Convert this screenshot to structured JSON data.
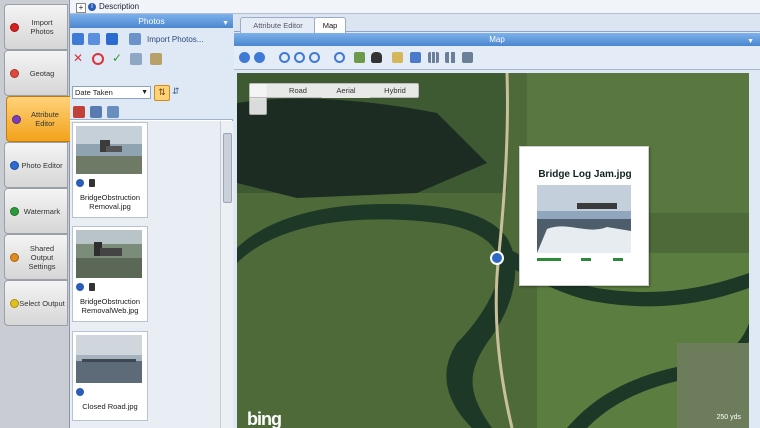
{
  "top_strip": {
    "description_label": "Description"
  },
  "workflow_tabs": [
    {
      "label": "Import Photos",
      "color": "#d72020",
      "active": false
    },
    {
      "label": "Geotag",
      "color": "#e0483a",
      "active": false
    },
    {
      "label": "Attribute Editor",
      "color": "#7b3db8",
      "active": true
    },
    {
      "label": "Photo Editor",
      "color": "#2c6bd0",
      "active": false
    },
    {
      "label": "Watermark",
      "color": "#2c9a3a",
      "active": false
    },
    {
      "label": "Shared Output Settings",
      "color": "#e08a20",
      "active": false
    },
    {
      "label": "Select Output",
      "color": "#e0c020",
      "active": false
    }
  ],
  "photos_panel": {
    "title": "Photos",
    "import_label": "Import Photos...",
    "sort_value": "Date Taken",
    "photos": [
      {
        "caption": "BridgeObstruction Removal.jpg"
      },
      {
        "caption": "BridgeObstruction RemovalWeb.jpg"
      },
      {
        "caption": "Closed Road.jpg"
      }
    ]
  },
  "tabs": {
    "attribute_editor": "Attribute Editor",
    "map": "Map"
  },
  "map_panel": {
    "title": "Map",
    "map_modes": [
      "Road",
      "Aerial",
      "Hybrid"
    ],
    "attribution": "bing",
    "scale": "250 yds",
    "popup_title": "Bridge Log Jam.jpg"
  },
  "colors": {
    "accent": "#4b86cf",
    "active_tab": "#f2a21a",
    "map_field": "#4f6b3a",
    "river": "#1f3a2b"
  }
}
